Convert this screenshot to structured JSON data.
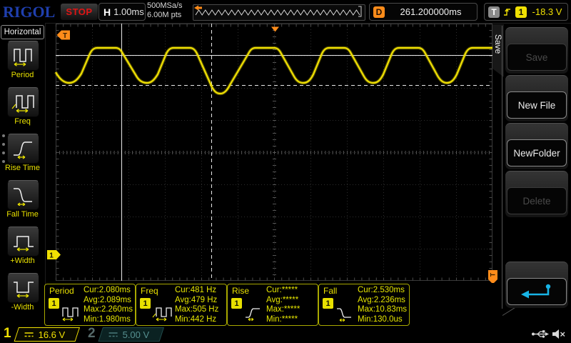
{
  "colors": {
    "trace": "#f0e003",
    "accent_orange": "#ff8c1a",
    "accent_cyan": "#18b4e6",
    "menu_text": "#e8e000"
  },
  "top_bar": {
    "logo": "RIGOL",
    "run_state": "STOP",
    "horizontal_label": "H",
    "horizontal_scale": "1.00ms",
    "sample_rate": "500MSa/s",
    "memory_depth": "6.00M pts",
    "delay_label": "D",
    "delay_value": "261.200000ms",
    "trigger_label": "T",
    "trigger_channel": "1",
    "trigger_level": "-18.3 V"
  },
  "left_menu": {
    "title": "Horizontal",
    "items": [
      {
        "label": "Period"
      },
      {
        "label": "Freq"
      },
      {
        "label": "Rise Time"
      },
      {
        "label": "Fall Time"
      },
      {
        "label": "+Width"
      },
      {
        "label": "-Width"
      }
    ]
  },
  "right_menu": {
    "tab": "Save",
    "buttons": [
      {
        "label": "Save",
        "enabled": false
      },
      {
        "label": "New File",
        "enabled": true
      },
      {
        "label": "NewFolder",
        "enabled": true
      },
      {
        "label": "Delete",
        "enabled": false
      }
    ],
    "return_button": {
      "icon": "return-arrow-icon",
      "enabled": true
    }
  },
  "measurements": [
    {
      "name": "Period",
      "channel": "1",
      "rows": [
        {
          "label": "Cur:",
          "value": "2.080ms"
        },
        {
          "label": "Avg:",
          "value": "2.089ms"
        },
        {
          "label": "Max:",
          "value": "2.260ms"
        },
        {
          "label": "Min:",
          "value": "1.980ms"
        }
      ]
    },
    {
      "name": "Freq",
      "channel": "1",
      "rows": [
        {
          "label": "Cur:",
          "value": "481 Hz"
        },
        {
          "label": "Avg:",
          "value": "479 Hz"
        },
        {
          "label": "Max:",
          "value": "505 Hz"
        },
        {
          "label": "Min:",
          "value": "442 Hz"
        }
      ]
    },
    {
      "name": "Rise",
      "channel": "1",
      "rows": [
        {
          "label": "Cur:",
          "value": "*****"
        },
        {
          "label": "Avg:",
          "value": "*****"
        },
        {
          "label": "Max:",
          "value": "*****"
        },
        {
          "label": "Min:",
          "value": "*****"
        }
      ]
    },
    {
      "name": "Fall",
      "channel": "1",
      "rows": [
        {
          "label": "Cur:",
          "value": "2.530ms"
        },
        {
          "label": "Avg:",
          "value": "2.236ms"
        },
        {
          "label": "Max:",
          "value": "10.83ms"
        },
        {
          "label": "Min:",
          "value": "130.0us"
        }
      ]
    }
  ],
  "channels": [
    {
      "id": "1",
      "scale": "16.6 V",
      "coupling": "DC",
      "active": true
    },
    {
      "id": "2",
      "scale": "5.00 V",
      "coupling": "DC",
      "active": false
    }
  ]
}
